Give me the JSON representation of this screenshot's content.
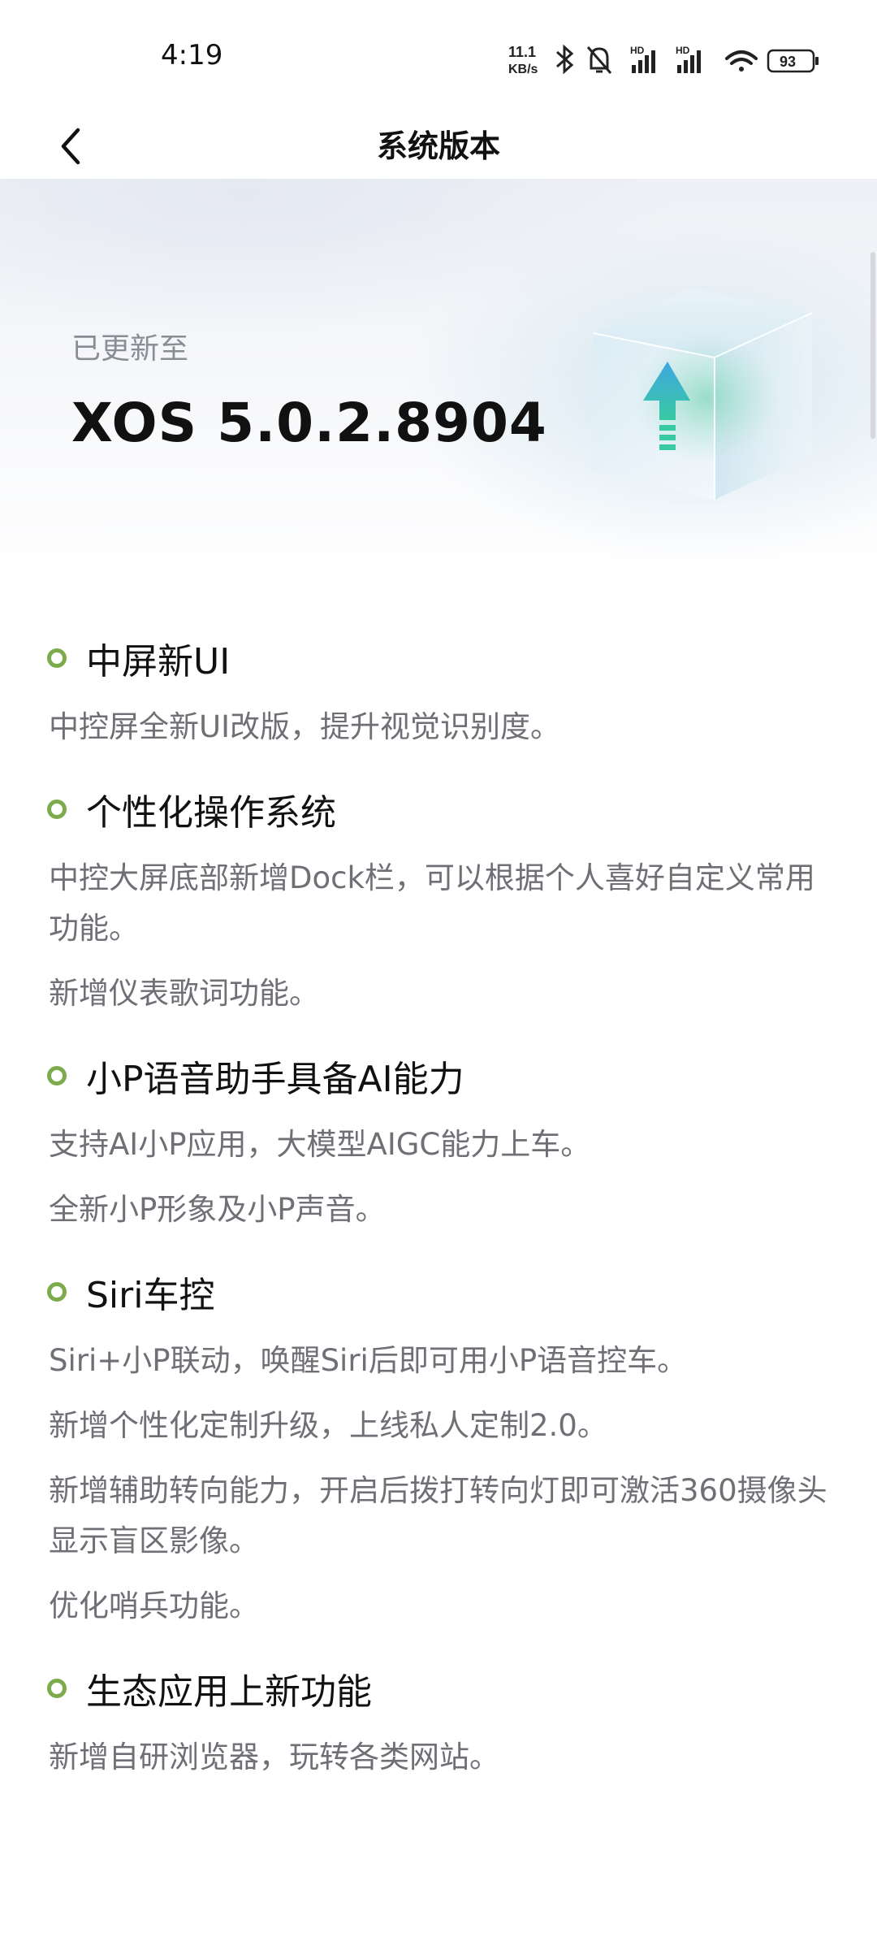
{
  "status_bar": {
    "time": "4:19",
    "net_speed_value": "11.1",
    "net_speed_unit": "KB/s",
    "hd_label": "HD",
    "battery": "93",
    "icons": [
      "bluetooth-icon",
      "mute-bell-icon",
      "signal-hd-icon",
      "signal-hd-icon",
      "wifi-icon",
      "battery-icon"
    ]
  },
  "nav": {
    "title": "系统版本",
    "back_icon": "chevron-left-icon"
  },
  "hero": {
    "updated_label": "已更新至",
    "version": "XOS 5.0.2.8904",
    "illustration": "upgrade-cube-icon"
  },
  "sections": [
    {
      "title": "中屏新UI",
      "paragraphs": [
        "中控屏全新UI改版，提升视觉识别度。"
      ]
    },
    {
      "title": "个性化操作系统",
      "paragraphs": [
        "中控大屏底部新增Dock栏，可以根据个人喜好自定义常用功能。",
        "新增仪表歌词功能。"
      ]
    },
    {
      "title": "小P语音助手具备AI能力",
      "paragraphs": [
        "支持AI小P应用，大模型AIGC能力上车。",
        "全新小P形象及小P声音。"
      ]
    },
    {
      "title": "Siri车控",
      "paragraphs": [
        "Siri+小P联动，唤醒Siri后即可用小P语音控车。",
        "新增个性化定制升级，上线私人定制2.0。",
        "新增辅助转向能力，开启后拨打转向灯即可激活360摄像头显示盲区影像。",
        "优化哨兵功能。"
      ]
    },
    {
      "title": "生态应用上新功能",
      "paragraphs": [
        "新增自研浏览器，玩转各类网站。"
      ]
    }
  ],
  "colors": {
    "bullet": "#7cab4c",
    "body_text": "#6e7076",
    "title_text": "#111111"
  }
}
